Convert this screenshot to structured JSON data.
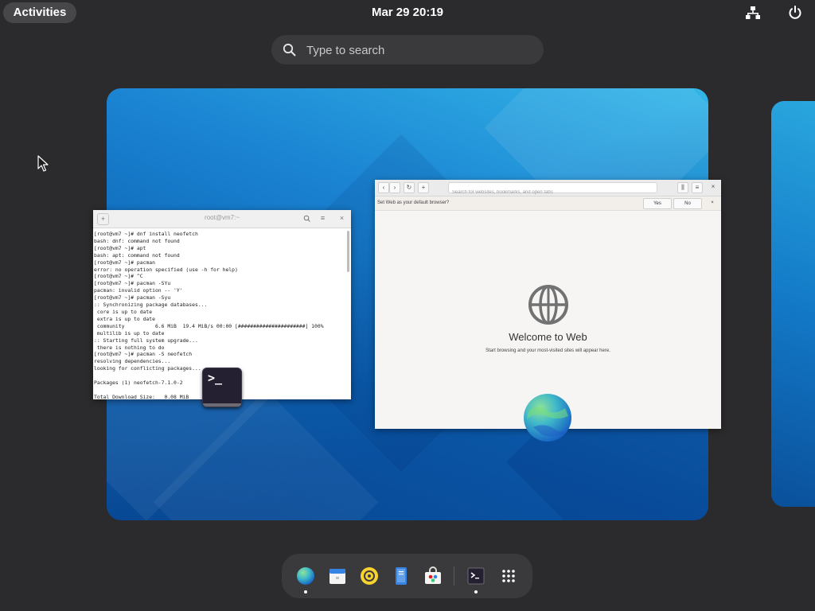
{
  "topbar": {
    "activities_label": "Activities",
    "clock": "Mar 29  20:19",
    "network_icon": "network-icon",
    "power_icon": "power-icon"
  },
  "search": {
    "placeholder": "Type to search"
  },
  "terminal": {
    "title": "root@vm7:~",
    "lines": [
      "[root@vm7 ~]# dnf install neofetch",
      "bash: dnf: command not found",
      "[root@vm7 ~]# apt",
      "bash: apt: command not found",
      "[root@vm7 ~]# pacman",
      "error: no operation specified (use -h for help)",
      "[root@vm7 ~]# ^C",
      "[root@vm7 ~]# pacman -SYu",
      "pacman: invalid option -- 'Y'",
      "[root@vm7 ~]# pacman -Syu",
      ":: Synchronizing package databases...",
      " core is up to date",
      " extra is up to date",
      " community          6.6 MiB  19.4 MiB/s 00:00 [######################] 100%",
      " multilib is up to date",
      ":: Starting full system upgrade...",
      " there is nothing to do",
      "[root@vm7 ~]# pacman -S neofetch",
      "resolving dependencies...",
      "looking for conflicting packages...",
      "",
      "Packages (1) neofetch-7.1.0-2",
      "",
      "Total Download Size:   0.08 MiB"
    ]
  },
  "browser": {
    "url_placeholder": "Search for websites, bookmarks, and open tabs",
    "infobar_text": "Set Web as your default browser?",
    "yes_label": "Yes",
    "no_label": "No",
    "welcome_title": "Welcome to Web",
    "welcome_subtitle": "Start browsing and your most-visited sites will appear here."
  },
  "dash": {
    "items": [
      {
        "name": "web-browser",
        "running": true
      },
      {
        "name": "calendar",
        "running": false
      },
      {
        "name": "music-player",
        "running": false
      },
      {
        "name": "text-editor",
        "running": false
      },
      {
        "name": "software-store",
        "running": false
      },
      {
        "name": "terminal",
        "running": true
      },
      {
        "name": "app-grid",
        "running": false
      }
    ]
  },
  "colors": {
    "background": "#2b2b2d",
    "panel": "#3a3a3c",
    "terminal_bg": "#241f31"
  }
}
